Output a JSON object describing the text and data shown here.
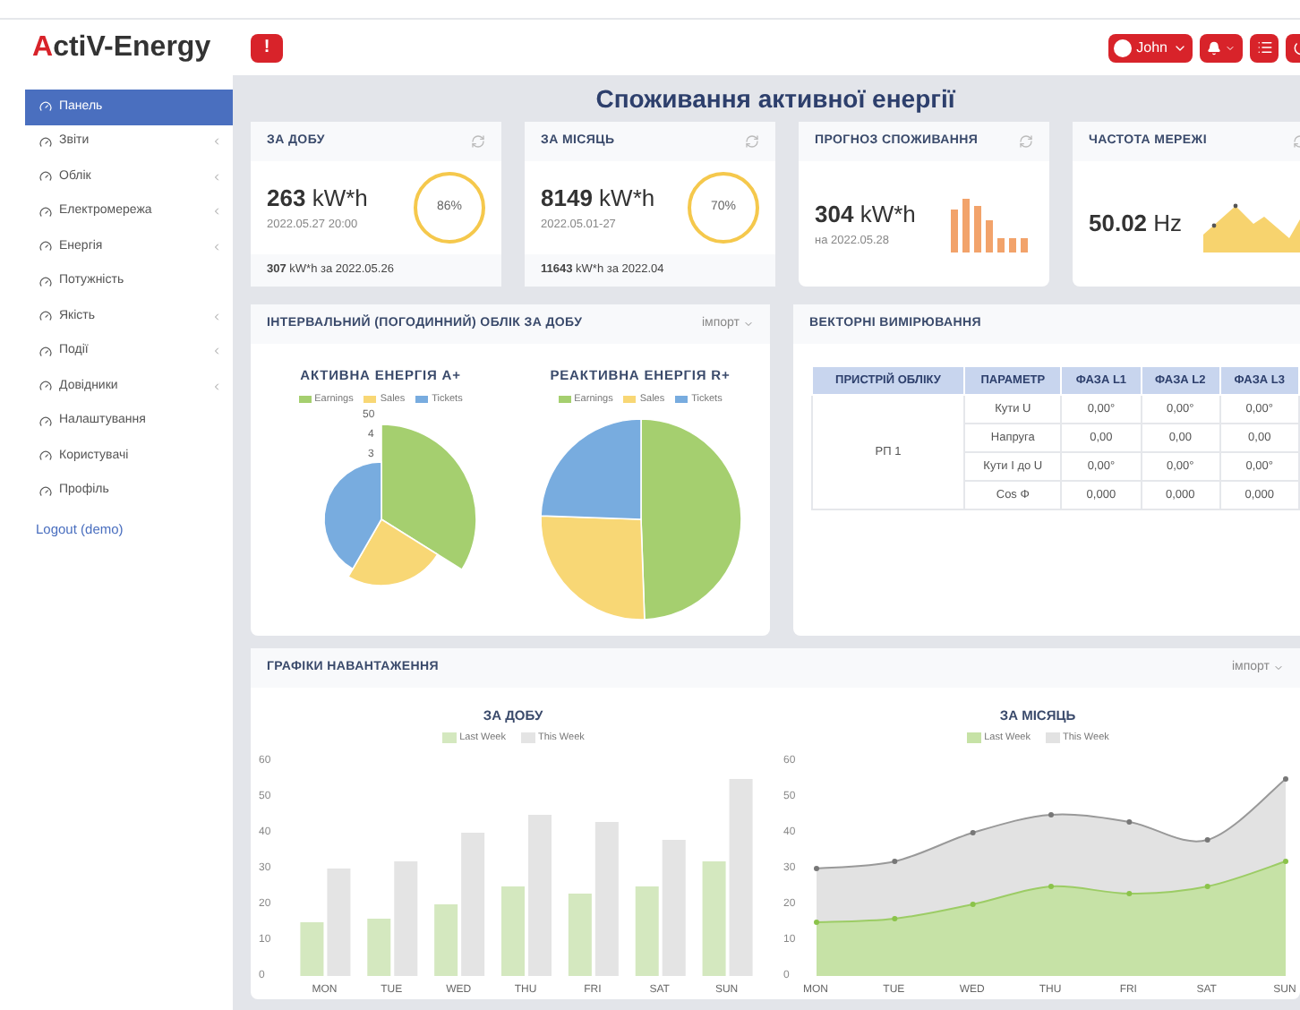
{
  "header": {
    "logo": "ActiV-Energy",
    "alert_button": "!",
    "user_button": "John"
  },
  "sidebar": {
    "items": [
      {
        "label": "Панель",
        "selected": true,
        "has_submenu": false
      },
      {
        "label": "Звіти",
        "selected": false,
        "has_submenu": true
      },
      {
        "label": "Облік",
        "selected": false,
        "has_submenu": true
      },
      {
        "label": "Електромережа",
        "selected": false,
        "has_submenu": true
      },
      {
        "label": "Енергія",
        "selected": false,
        "has_submenu": true
      },
      {
        "label": "Потужність",
        "selected": false,
        "has_submenu": false
      },
      {
        "label": "Якість",
        "selected": false,
        "has_submenu": true
      },
      {
        "label": "Події",
        "selected": false,
        "has_submenu": true
      },
      {
        "label": "Довідники",
        "selected": false,
        "has_submenu": true
      },
      {
        "label": "Налаштування",
        "selected": false,
        "has_submenu": false
      },
      {
        "label": "Користувачі",
        "selected": false,
        "has_submenu": false
      },
      {
        "label": "Профіль",
        "selected": false,
        "has_submenu": false
      }
    ],
    "logout": "Logout (demo)"
  },
  "page_title": "Споживання активної енергії",
  "stat_cards": [
    {
      "kind": "gauge",
      "title": "ЗА ДОБУ",
      "value": "263",
      "unit": "kW*h",
      "sub": "2022.05.27 20:00",
      "gauge_label": "86%",
      "footer": "**307** kW*h за 2022.05.26"
    },
    {
      "kind": "gauge",
      "title": "ЗА МІСЯЦЬ",
      "value": "8149",
      "unit": "kW*h",
      "sub": "2022.05.01-27",
      "gauge_label": "70%",
      "footer": "**11643** kW*h за 2022.04"
    },
    {
      "kind": "bars",
      "title": "ПРОГНОЗ СПОЖИВАННЯ",
      "value": "304",
      "unit": "kW*h",
      "sub": "на 2022.05.28"
    },
    {
      "kind": "area",
      "title": "ЧАСТОТА МЕРЕЖІ",
      "value": "50.02",
      "unit": "Hz"
    }
  ],
  "interval_panel": {
    "title": "ІНТЕРВАЛЬНИЙ (ПОГОДИННИЙ) ОБЛІК ЗА ДОБУ",
    "menu": "імпорт",
    "charts": [
      {
        "kind": "polar",
        "title": "АКТИВНА ЕНЕРГІЯ A+",
        "axis_labels": [
          "50",
          "4",
          "3"
        ],
        "legend": [
          {
            "label": "Earnings",
            "color": "#a5cf6f"
          },
          {
            "label": "Sales",
            "color": "#f8d775"
          },
          {
            "label": "Tickets",
            "color": "#78acdf"
          }
        ]
      },
      {
        "kind": "pie",
        "title": "РЕАКТИВНА ЕНЕРГІЯ R+",
        "legend": [
          {
            "label": "Earnings",
            "color": "#a5cf6f"
          },
          {
            "label": "Sales",
            "color": "#f8d775"
          },
          {
            "label": "Tickets",
            "color": "#78acdf"
          }
        ]
      }
    ]
  },
  "vector_panel": {
    "title": "ВЕКТОРНІ ВИМІРЮВАННЯ",
    "columns": [
      "ПРИСТРІЙ ОБЛІКУ",
      "ПАРАМЕТР",
      "ФАЗА L1",
      "ФАЗА L2",
      "ФАЗА L3"
    ],
    "device": "РП 1",
    "rows": [
      {
        "parameter": "Кути U",
        "values": [
          "0,00°",
          "0,00°",
          "0,00°"
        ]
      },
      {
        "parameter": "Напруга",
        "values": [
          "0,00",
          "0,00",
          "0,00"
        ]
      },
      {
        "parameter": "Кути I до U",
        "values": [
          "0,00°",
          "0,00°",
          "0,00°"
        ]
      },
      {
        "parameter": "Cos Φ",
        "values": [
          "0,000",
          "0,000",
          "0,000"
        ]
      }
    ]
  },
  "load_panel": {
    "title": "ГРАФІКИ НАВАНТАЖЕННЯ",
    "menu": "імпорт",
    "charts": [
      {
        "title": "ЗА ДОБУ",
        "chart_data": {
          "type": "bar",
          "categories": [
            "MON",
            "TUE",
            "WED",
            "THU",
            "FRI",
            "SAT",
            "SUN"
          ],
          "ylim": [
            0,
            60
          ],
          "yticks": [
            0,
            10,
            20,
            30,
            40,
            50,
            60
          ],
          "series": [
            {
              "name": "Last Week",
              "color": "#d4e8bf",
              "values": [
                15,
                16,
                20,
                25,
                23,
                25,
                32
              ]
            },
            {
              "name": "This Week",
              "color": "#e4e4e4",
              "values": [
                30,
                32,
                40,
                45,
                43,
                38,
                55
              ]
            }
          ]
        }
      },
      {
        "title": "ЗА МІСЯЦЬ",
        "chart_data": {
          "type": "area",
          "categories": [
            "MON",
            "TUE",
            "WED",
            "THU",
            "FRI",
            "SAT",
            "SUN"
          ],
          "ylim": [
            0,
            60
          ],
          "yticks": [
            0,
            10,
            20,
            30,
            40,
            50,
            60
          ],
          "series": [
            {
              "name": "Last Week",
              "color": "#c6e2a6",
              "values": [
                15,
                16,
                20,
                25,
                23,
                25,
                32
              ]
            },
            {
              "name": "This Week",
              "color": "#e2e2e2",
              "values": [
                30,
                32,
                40,
                45,
                43,
                38,
                55
              ]
            }
          ]
        }
      }
    ]
  }
}
